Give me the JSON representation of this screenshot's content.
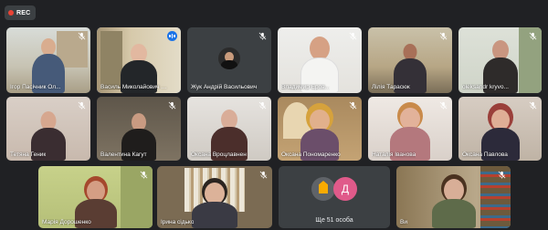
{
  "recording": {
    "label": "REC"
  },
  "icons": {
    "mic_off": "mic-off-icon",
    "speaking": "speaking-indicator-icon"
  },
  "colors": {
    "speaking_outline": "#8ab4f8",
    "rec_red": "#ea4335",
    "tile_bg": "#3c4043"
  },
  "participants": [
    {
      "name": "Ігор Пасічник Ол..."
    },
    {
      "name": "Василь Миколайович Ж..."
    },
    {
      "name": "Жук Андрій Васильович"
    },
    {
      "name": "Владимир Еров..."
    },
    {
      "name": "Лілія Тарасюк"
    },
    {
      "name": "oleksandr kryvo..."
    },
    {
      "name": "Тетяна Геник"
    },
    {
      "name": "Валентина Кагут"
    },
    {
      "name": "Оксана Вроцлавнен"
    },
    {
      "name": "Оксана Пономаренко"
    },
    {
      "name": "Наталія Іванова"
    },
    {
      "name": "Оксана Павлова"
    },
    {
      "name": "Марія Дорошенко"
    },
    {
      "name": "Ірина сідько"
    },
    {
      "name": "Ви"
    }
  ],
  "others_tile": {
    "label": "Ще 51 особа",
    "avatar_letter": "Д"
  }
}
